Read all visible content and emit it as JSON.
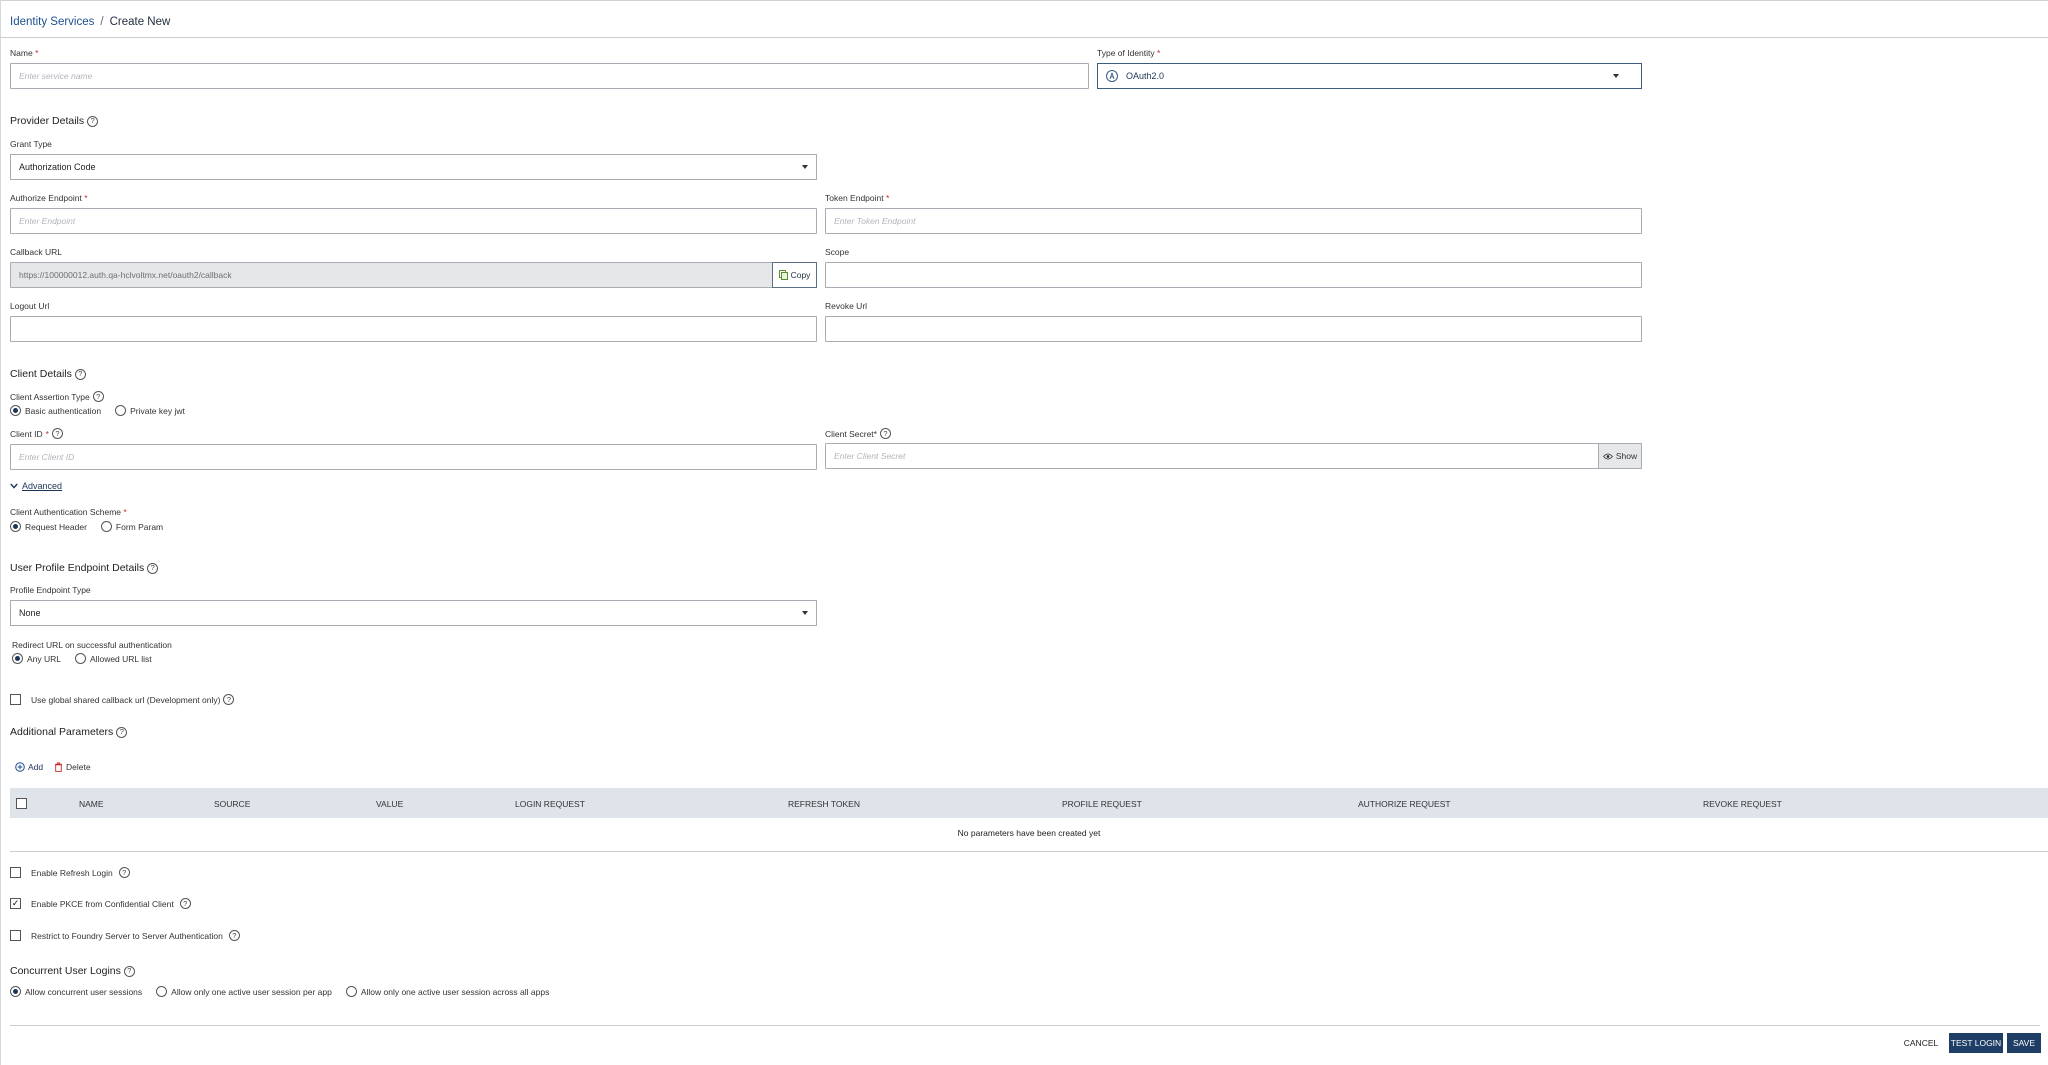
{
  "breadcrumb": {
    "root": "Identity Services",
    "separator": "/",
    "current": "Create New"
  },
  "name_field": {
    "label": "Name",
    "required": "*",
    "placeholder": "Enter service name"
  },
  "identity_type": {
    "label": "Type of Identity",
    "required": "*",
    "value": "OAuth2.0"
  },
  "provider": {
    "title": "Provider Details",
    "grant_type": {
      "label": "Grant Type",
      "value": "Authorization Code"
    },
    "authorize_endpoint": {
      "label": "Authorize Endpoint",
      "required": "*",
      "placeholder": "Enter Endpoint"
    },
    "token_endpoint": {
      "label": "Token Endpoint",
      "required": "*",
      "placeholder": "Enter Token Endpoint"
    },
    "callback_url": {
      "label": "Callback URL",
      "value": "https://100000012.auth.qa-hclvoltmx.net/oauth2/callback",
      "copy_label": "Copy"
    },
    "scope": {
      "label": "Scope",
      "value": ""
    },
    "logout_url": {
      "label": "Logout Url",
      "value": ""
    },
    "revoke_url": {
      "label": "Revoke Url",
      "value": ""
    }
  },
  "client": {
    "title": "Client Details",
    "assertion_type": {
      "label": "Client Assertion Type",
      "options": [
        "Basic authentication",
        "Private key jwt"
      ]
    },
    "client_id": {
      "label": "Client ID",
      "required": "*",
      "placeholder": "Enter Client ID"
    },
    "client_secret": {
      "label": "Client Secret*",
      "placeholder": "Enter Client Secret",
      "show_label": "Show"
    }
  },
  "advanced": {
    "toggle_label": "Advanced",
    "auth_scheme": {
      "label": "Client Authentication Scheme",
      "required": "*",
      "options": [
        "Request Header",
        "Form Param"
      ]
    }
  },
  "user_profile": {
    "title": "User Profile Endpoint Details",
    "endpoint_type": {
      "label": "Profile Endpoint Type",
      "value": "None"
    },
    "redirect": {
      "label": "Redirect URL on successful authentication",
      "options": [
        "Any URL",
        "Allowed URL list"
      ]
    }
  },
  "global_callback": {
    "label": "Use global shared callback url (Development only)",
    "checked": false
  },
  "additional_params": {
    "title": "Additional Parameters",
    "add_label": "Add",
    "delete_label": "Delete",
    "columns": [
      "NAME",
      "SOURCE",
      "VALUE",
      "LOGIN REQUEST",
      "REFRESH TOKEN",
      "PROFILE REQUEST",
      "AUTHORIZE REQUEST",
      "REVOKE REQUEST"
    ],
    "empty_message": "No parameters have been created yet"
  },
  "options": {
    "refresh_login": {
      "label": "Enable Refresh Login",
      "checked": false
    },
    "pkce": {
      "label": "Enable PKCE from Confidential Client",
      "checked": true,
      "mark": "✓"
    },
    "restrict": {
      "label": "Restrict to Foundry Server to Server Authentication",
      "checked": false
    }
  },
  "concurrent": {
    "title": "Concurrent User Logins",
    "options": [
      "Allow concurrent user sessions",
      "Allow only one active user session per app",
      "Allow only one active user session across all apps"
    ]
  },
  "footer": {
    "cancel": "CANCEL",
    "test_login": "TEST LOGIN",
    "save": "SAVE"
  },
  "colors": {
    "primary": "#1e3e66",
    "link": "#1d4f8f",
    "required": "#c62828",
    "table_header": "#dfe3ea"
  }
}
